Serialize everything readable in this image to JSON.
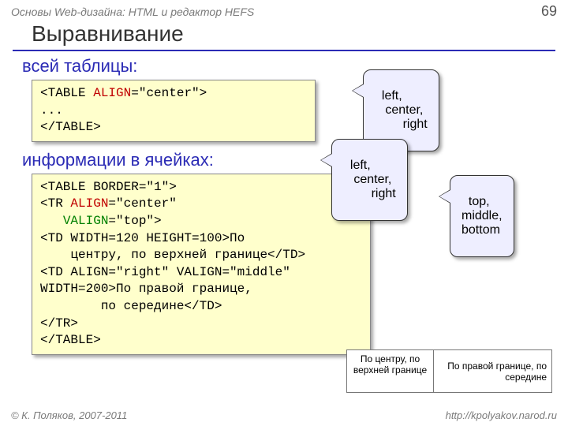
{
  "header": {
    "topic": "Основы Web-дизайна: HTML и редактор HEFS",
    "page": "69"
  },
  "title": "Выравнивание",
  "sub1": "всей таблицы:",
  "sub2": "информации в ячейках:",
  "code1": {
    "l1a": "<TABLE ",
    "l1b": "ALIGN",
    "l1c": "=\"center\">",
    "l2": "...",
    "l3": "</TABLE>"
  },
  "code2": {
    "l1": "<TABLE BORDER=\"1\">",
    "l2a": "<TR ",
    "l2b": "ALIGN",
    "l2c": "=\"center\"",
    "l3a": "   ",
    "l3b": "VALIGN",
    "l3c": "=\"top\">",
    "l4": "  <TD WIDTH=120 HEIGHT=100>По",
    "l5": "    центру, по верхней границе</TD>",
    "l6": "  <TD ALIGN=\"right\" VALIGN=\"middle\"",
    "l7": "  WIDTH=200>По правой границе,",
    "l8": "        по середине</TD>",
    "l9": "</TR>",
    "l10": "</TABLE>"
  },
  "callout1": "left,\n   center,\n        right",
  "callout2": "left,\n   center,\n        right",
  "callout3": "top,\nmiddle,\nbottom",
  "sample": {
    "c1": "По центру, по верхней границе",
    "c2": "По правой границе, по середине"
  },
  "footer": {
    "left": "© К. Поляков, 2007-2011",
    "right": "http://kpolyakov.narod.ru"
  }
}
